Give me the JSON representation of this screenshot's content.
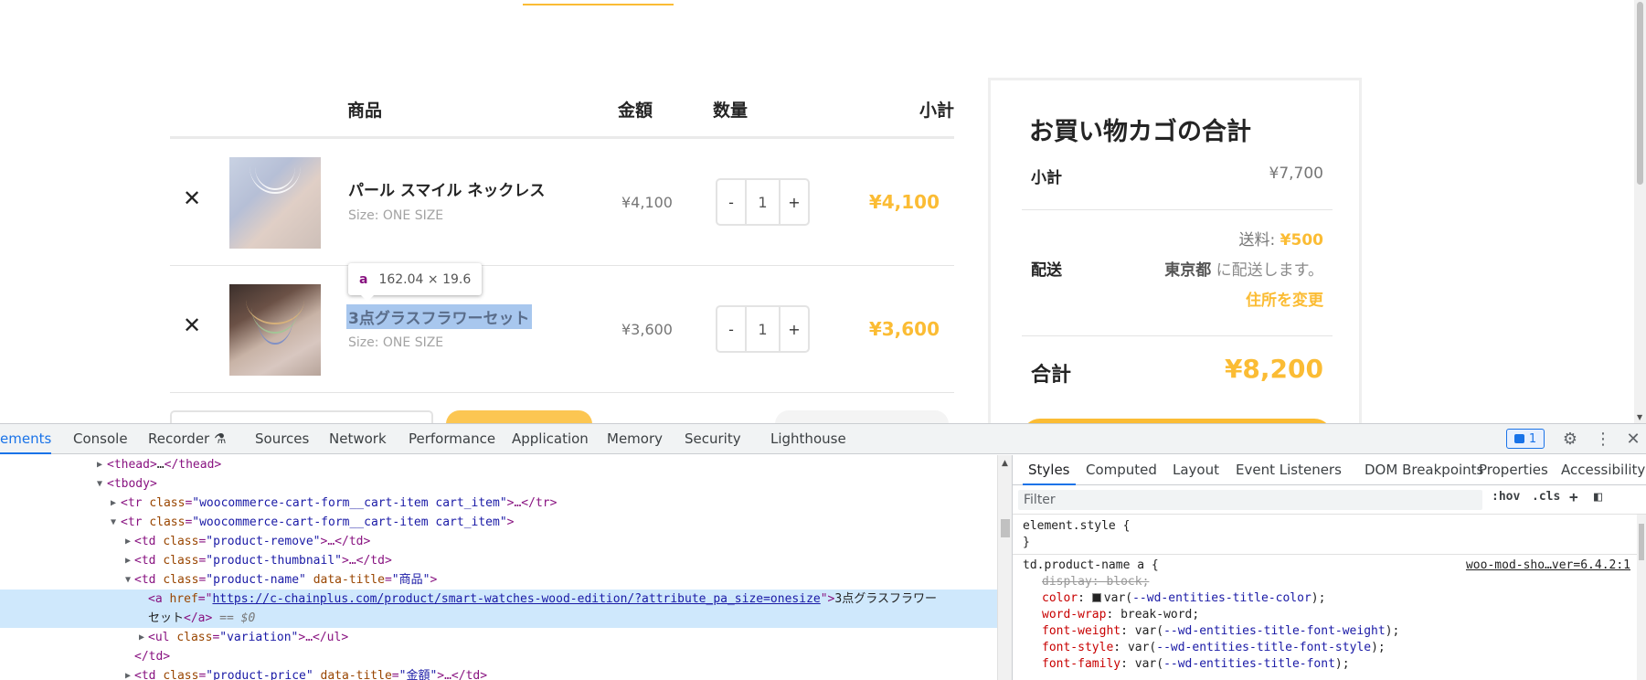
{
  "cart": {
    "headers": {
      "product": "商品",
      "price": "金額",
      "quantity": "数量",
      "subtotal": "小計"
    },
    "items": [
      {
        "remove": "✕",
        "name": "パール スマイル ネックレス",
        "size": "Size: ONE SIZE",
        "price": "¥4,100",
        "qty_minus": "-",
        "qty": "1",
        "qty_plus": "+",
        "subtotal": "¥4,100"
      },
      {
        "remove": "✕",
        "name": "3点グラスフラワーセット",
        "size": "Size: ONE SIZE",
        "price": "¥3,600",
        "qty_minus": "-",
        "qty": "1",
        "qty_plus": "+",
        "subtotal": "¥3,600"
      }
    ]
  },
  "inspect_tooltip": {
    "tag": "a",
    "size": "162.04 × 19.6"
  },
  "totals": {
    "title": "お買い物カゴの合計",
    "subtotal_label": "小計",
    "subtotal_value": "¥7,700",
    "shipping_label": "配送",
    "shipping_fee_prefix": "送料: ",
    "shipping_fee": "¥500",
    "shipping_dest_pref": "東京都",
    "shipping_dest_suffix": " に配送します。",
    "change_address": "住所を変更",
    "total_label": "合計",
    "total_value": "¥8,200"
  },
  "devtools": {
    "tabs": [
      "ements",
      "Console",
      "Recorder ⚗",
      "Sources",
      "Network",
      "Performance",
      "Application",
      "Memory",
      "Security",
      "Lighthouse"
    ],
    "active_tab": "ements",
    "issues_count": "1",
    "dom": {
      "thead": [
        "<thead>",
        "…",
        "</thead>"
      ],
      "tbody": "<tbody>",
      "tr1": {
        "open": "<tr ",
        "attr": "class",
        "val": "\"woocommerce-cart-form__cart-item cart_item\"",
        "close": ">…</tr>"
      },
      "tr2": {
        "open": "<tr ",
        "attr": "class",
        "val": "\"woocommerce-cart-form__cart-item cart_item\"",
        "close": ">"
      },
      "td_remove": {
        "open": "<td ",
        "attr": "class",
        "val": "\"product-remove\"",
        "close": ">…</td>"
      },
      "td_thumb": {
        "open": "<td ",
        "attr": "class",
        "val": "\"product-thumbnail\"",
        "close": ">…</td>"
      },
      "td_name": {
        "open": "<td ",
        "attr": "class",
        "val": "\"product-name\"",
        "attr2": "data-title",
        "val2": "\"商品\"",
        "close": ">"
      },
      "a_line": {
        "open": "<a ",
        "attr": "href",
        "eqq": "=\"",
        "href": "https://c-chainplus.com/product/smart-watches-wood-edition/?attribute_pa_size=onesize",
        "close_q": "\">",
        "text1": "3点グラスフラワー",
        "text2": "セット",
        "end": "</a>",
        "dollar": " == $0"
      },
      "ul": {
        "open": "<ul ",
        "attr": "class",
        "val": "\"variation\"",
        "close": ">…</ul>"
      },
      "td_close": "</td>",
      "td_price": {
        "open": "<td ",
        "attr": "class",
        "val": "\"product-price\"",
        "attr2": "data-title",
        "val2": "\"金額\"",
        "close": ">…</td>"
      }
    },
    "styles_tabs": [
      "Styles",
      "Computed",
      "Layout",
      "Event Listeners",
      "DOM Breakpoints",
      "Properties",
      "Accessibility"
    ],
    "filter_placeholder": "Filter",
    "hov": ":hov",
    "cls": ".cls",
    "plus": "+",
    "element_style": "element.style {",
    "close_brace": "}",
    "rule_selector": "td.product-name a {",
    "rule_source": "woo-mod-sho…ver=6.4.2:1",
    "rules": [
      {
        "prop": "display",
        "value": "block;",
        "struck": true
      },
      {
        "prop": "color",
        "value_pre": "var(",
        "var": "--wd-entities-title-color",
        "value_post": ");",
        "swatch": true
      },
      {
        "prop": "word-wrap",
        "value": "break-word;"
      },
      {
        "prop": "font-weight",
        "value_pre": "var(",
        "var": "--wd-entities-title-font-weight",
        "value_post": ");"
      },
      {
        "prop": "font-style",
        "value_pre": "var(",
        "var": "--wd-entities-title-font-style",
        "value_post": ");"
      },
      {
        "prop": "font-family",
        "value_pre": "var(",
        "var": "--wd-entities-title-font",
        "value_post": ");"
      }
    ]
  }
}
